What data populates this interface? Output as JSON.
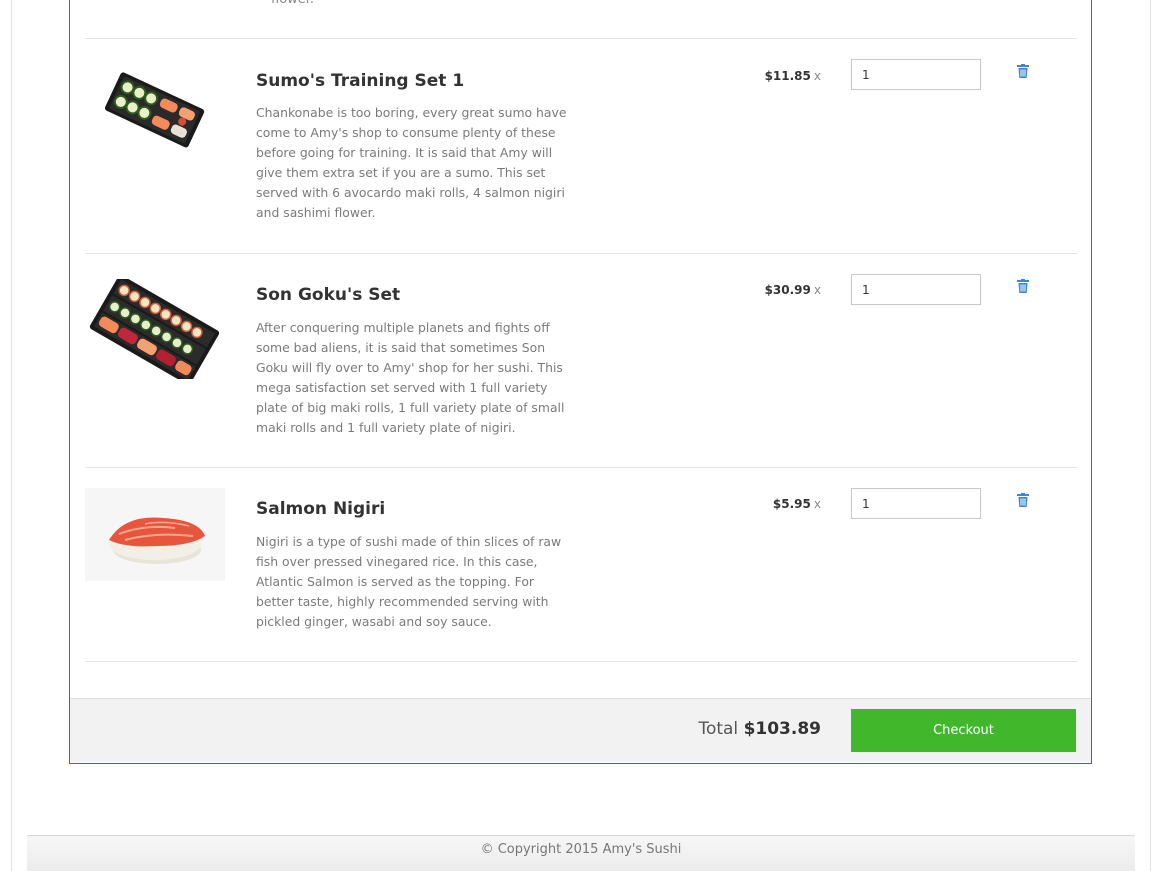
{
  "top_fragment": "flower.",
  "items": [
    {
      "title": "Sumo's Training Set 1",
      "description": "Chankonabe is too boring, every great sumo have come to Amy's shop to consume plenty of these before going for training. It is said that Amy will give them extra set if you are a sumo. This set served with 6 avocardo maki rolls, 4 salmon nigiri and sashimi flower.",
      "price": "$11.85",
      "multiplier": "x",
      "quantity": "1",
      "image": "sushi-tray-image"
    },
    {
      "title": "Son Goku's Set",
      "description": "After conquering multiple planets and fights off some bad aliens, it is said that sometimes Son Goku will fly over to Amy' shop for her sushi. This mega satisfaction set served with 1 full variety plate of big maki rolls, 1 full variety plate of small maki rolls and 1 full variety plate of nigiri.",
      "price": "$30.99",
      "multiplier": "x",
      "quantity": "1",
      "image": "sushi-platter-image"
    },
    {
      "title": "Salmon Nigiri",
      "description": "Nigiri is a type of sushi made of thin slices of raw fish over pressed vinegared rice. In this case, Atlantic Salmon is served as the topping. For better taste, highly recommended serving with pickled ginger, wasabi and soy sauce.",
      "price": "$5.95",
      "multiplier": "x",
      "quantity": "1",
      "image": "salmon-nigiri-image"
    }
  ],
  "footer": {
    "total_label": "Total",
    "total_value": "$103.89",
    "checkout_label": "Checkout"
  },
  "copyright": "© Copyright 2015 Amy's Sushi",
  "colors": {
    "checkout": "#41b82b",
    "panel_border": "#7b4a9a",
    "trash_icon": "#3b87d6"
  }
}
